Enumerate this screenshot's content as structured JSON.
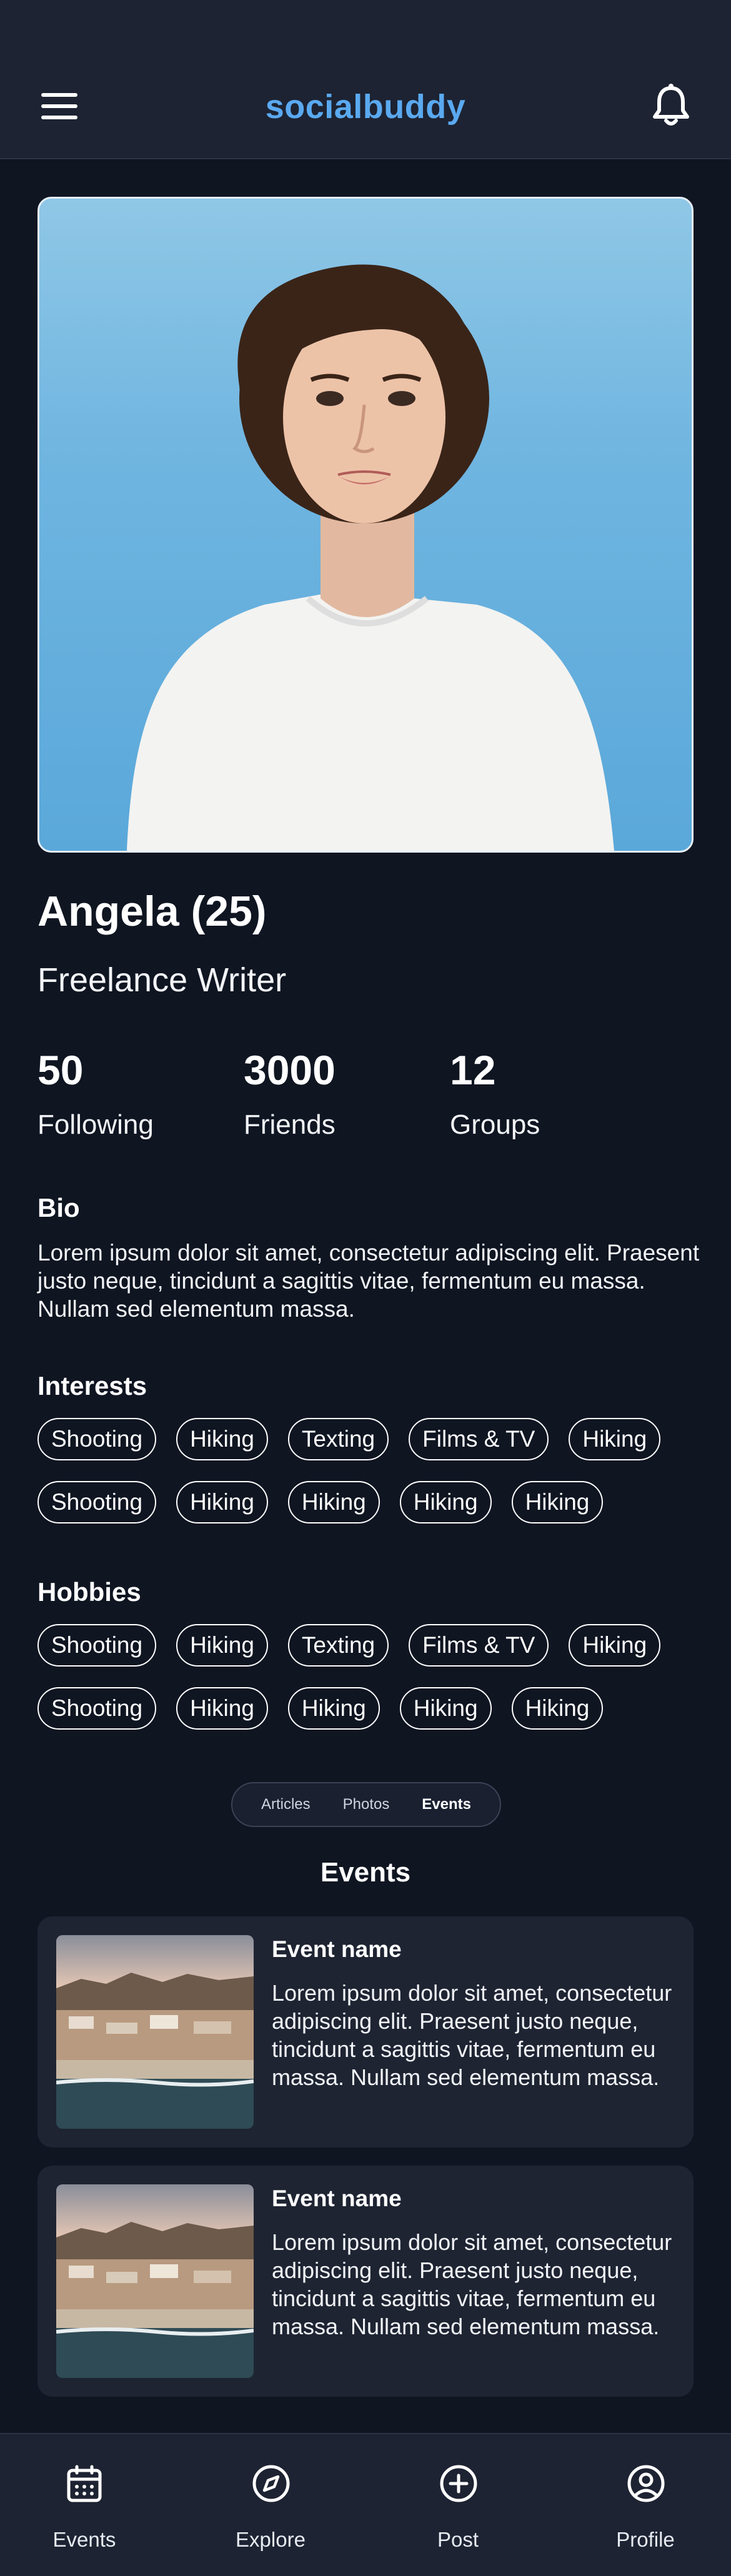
{
  "app": {
    "title": "socialbuddy"
  },
  "profile": {
    "name": "Angela (25)",
    "occupation": "Freelance Writer",
    "stats": [
      {
        "value": "50",
        "label": "Following"
      },
      {
        "value": "3000",
        "label": "Friends"
      },
      {
        "value": "12",
        "label": "Groups"
      }
    ],
    "bio_title": "Bio",
    "bio": "Lorem ipsum dolor sit amet, consectetur adipiscing elit. Praesent justo neque, tincidunt a sagittis vitae, fermentum eu massa. Nullam sed elementum massa."
  },
  "interests": {
    "title": "Interests",
    "rows": [
      [
        "Shooting",
        "Hiking",
        "Texting",
        "Films & TV",
        "Hiking"
      ],
      [
        "Shooting",
        "Hiking",
        "Hiking",
        "Hiking",
        "Hiking"
      ]
    ]
  },
  "hobbies": {
    "title": "Hobbies",
    "rows": [
      [
        "Shooting",
        "Hiking",
        "Texting",
        "Films & TV",
        "Hiking"
      ],
      [
        "Shooting",
        "Hiking",
        "Hiking",
        "Hiking",
        "Hiking"
      ]
    ]
  },
  "tabs": {
    "items": [
      "Articles",
      "Photos",
      "Events"
    ],
    "active": "Events"
  },
  "events": {
    "heading": "Events",
    "items": [
      {
        "title": "Event name",
        "description": "Lorem ipsum dolor sit amet, consectetur adipiscing elit. Praesent justo neque, tincidunt a sagittis vitae, fermentum eu massa. Nullam sed elementum massa."
      },
      {
        "title": "Event name",
        "description": "Lorem ipsum dolor sit amet, consectetur adipiscing elit. Praesent justo neque, tincidunt a sagittis vitae, fermentum eu massa. Nullam sed elementum massa."
      }
    ]
  },
  "bottom_nav": [
    {
      "label": "Events",
      "icon": "calendar-icon"
    },
    {
      "label": "Explore",
      "icon": "compass-icon"
    },
    {
      "label": "Post",
      "icon": "plus-circle-icon"
    },
    {
      "label": "Profile",
      "icon": "user-circle-icon"
    }
  ],
  "colors": {
    "background": "#0f1521",
    "bar": "#1d2332",
    "card": "#1e2432",
    "accent": "#5aa9f0"
  }
}
